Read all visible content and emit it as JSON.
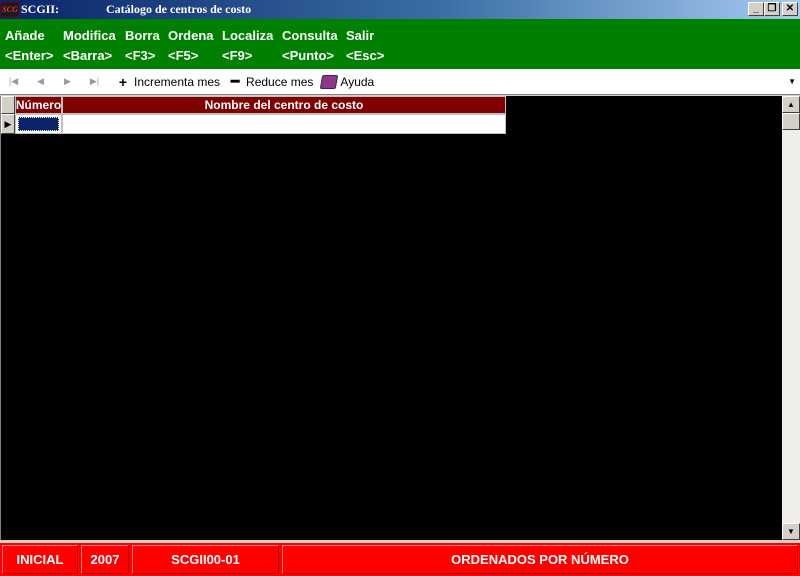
{
  "titlebar": {
    "logo_text": "SCG",
    "app_name": "SCGII:",
    "window_title": "Catálogo de centros de costo",
    "minimize_glyph": "_",
    "restore_glyph": "❐",
    "close_glyph": "✕"
  },
  "commands": [
    {
      "label": "Añade",
      "key": "<Enter>"
    },
    {
      "label": "Modifica",
      "key": "<Barra>"
    },
    {
      "label": "Borra",
      "key": "<F3>"
    },
    {
      "label": "Ordena",
      "key": "<F5>"
    },
    {
      "label": "Localiza",
      "key": "<F9>"
    },
    {
      "label": "Consulta",
      "key": "<Punto>"
    },
    {
      "label": "Salir",
      "key": "<Esc>"
    }
  ],
  "toolbar": {
    "first_glyph": "|◀",
    "prev_glyph": "◀",
    "next_glyph": "▶",
    "last_glyph": "▶|",
    "increment_icon": "+",
    "increment_label": "Incrementa mes",
    "reduce_icon": "━",
    "reduce_label": "Reduce mes",
    "help_label": "Ayuda",
    "dropdown_glyph": "▼"
  },
  "grid": {
    "columns": [
      "Número",
      "Nombre del centro de costo"
    ],
    "row_indicator": "▶"
  },
  "scrollbar": {
    "up_glyph": "▲",
    "down_glyph": "▼"
  },
  "status": {
    "mode": "INICIAL",
    "year": "2007",
    "module": "SCGII00-01",
    "message": "ORDENADOS POR NÚMERO"
  },
  "colors": {
    "command_bar": "#008000",
    "header": "#800000",
    "status_bar": "#ff0000",
    "grid_background": "#000000"
  }
}
